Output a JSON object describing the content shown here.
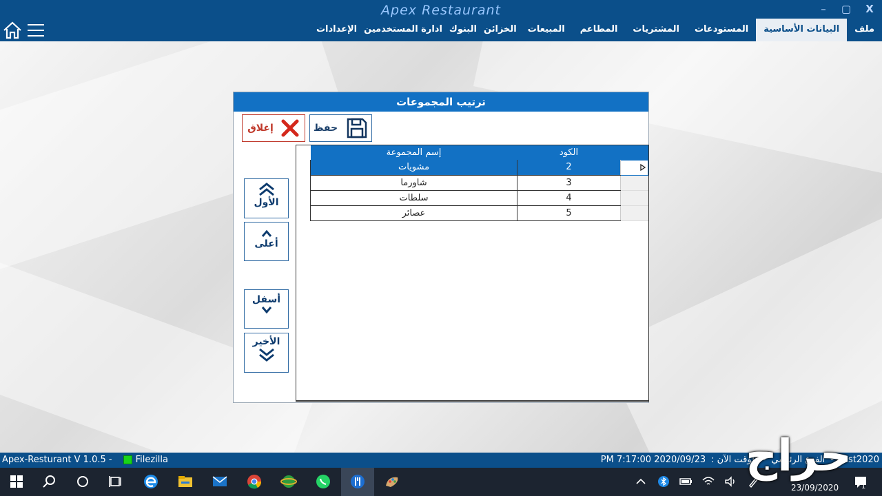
{
  "app": {
    "title": "Apex Restaurant",
    "controls": {
      "minimize": "–",
      "maximize": "▢",
      "close": "X"
    }
  },
  "menu": {
    "tabs": [
      "ملف",
      "البيانات الأساسية",
      "المستودعات",
      "المشتريات",
      "المطاعم",
      "المبيعات",
      "الخزائن",
      "البنوك",
      "ادارة المستخدمين",
      "الإعدادات"
    ],
    "active_index": 1
  },
  "dialog": {
    "title": "ترتيب المجموعات",
    "save_label": "حفظ",
    "close_label": "إغلاق",
    "nav": {
      "first": "الأول",
      "up": "أعلى",
      "down": "أسفل",
      "last": "الأخير"
    },
    "grid": {
      "columns": {
        "name": "إسم المجموعة",
        "code": "الكود"
      },
      "rows": [
        {
          "name": "مشويات",
          "code": "2"
        },
        {
          "name": "شاورما",
          "code": "3"
        },
        {
          "name": "سلطات",
          "code": "4"
        },
        {
          "name": "عصائر",
          "code": "5"
        }
      ],
      "selected_index": 0
    }
  },
  "status": {
    "version": "Apex-Resturant V 1.0.5  -",
    "ftp": "Filezilla",
    "db": "rest2020",
    "branch": "الفرع الرئيسي",
    "time_label": "الوقت الآن :",
    "datetime": "PM 7:17:00 2020/09/23"
  },
  "taskbar": {
    "date": "23/09/2020",
    "notifications": "1"
  },
  "watermark": "حراج"
}
